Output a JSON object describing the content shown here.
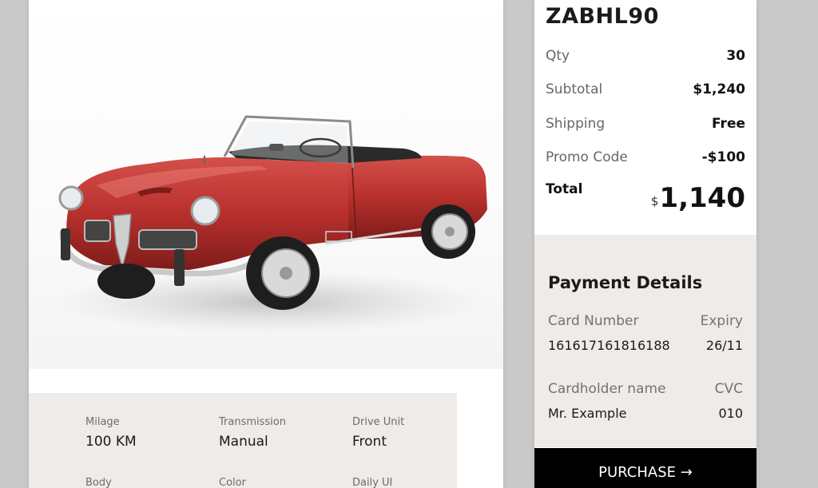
{
  "product": {
    "image_alt": "Red classic convertible car",
    "specs": [
      {
        "label": "Milage",
        "value": "100 KM"
      },
      {
        "label": "Transmission",
        "value": "Manual"
      },
      {
        "label": "Drive Unit",
        "value": "Front"
      },
      {
        "label": "Body",
        "value": ""
      },
      {
        "label": "Color",
        "value": ""
      },
      {
        "label": "Daily UI",
        "value": ""
      }
    ]
  },
  "order": {
    "title": "ZABHL90",
    "rows": [
      {
        "label": "Qty",
        "value": "30"
      },
      {
        "label": "Subtotal",
        "value": "$1,240"
      },
      {
        "label": "Shipping",
        "value": "Free"
      },
      {
        "label": "Promo Code",
        "value": "-$100"
      }
    ],
    "total_label": "Total",
    "total_currency": "$",
    "total_value": "1,140"
  },
  "payment": {
    "title": "Payment Details",
    "card_number_label": "Card Number",
    "card_number": "161617161816188",
    "expiry_label": "Expiry",
    "expiry": "26/11",
    "holder_label": "Cardholder name",
    "holder": "Mr. Example",
    "cvc_label": "CVC",
    "cvc": "010"
  },
  "purchase_label": "PURCHASE →",
  "colors": {
    "background": "#c9c9c9",
    "panel": "#eeebe8",
    "button": "#000000",
    "car": "#b8302d"
  }
}
